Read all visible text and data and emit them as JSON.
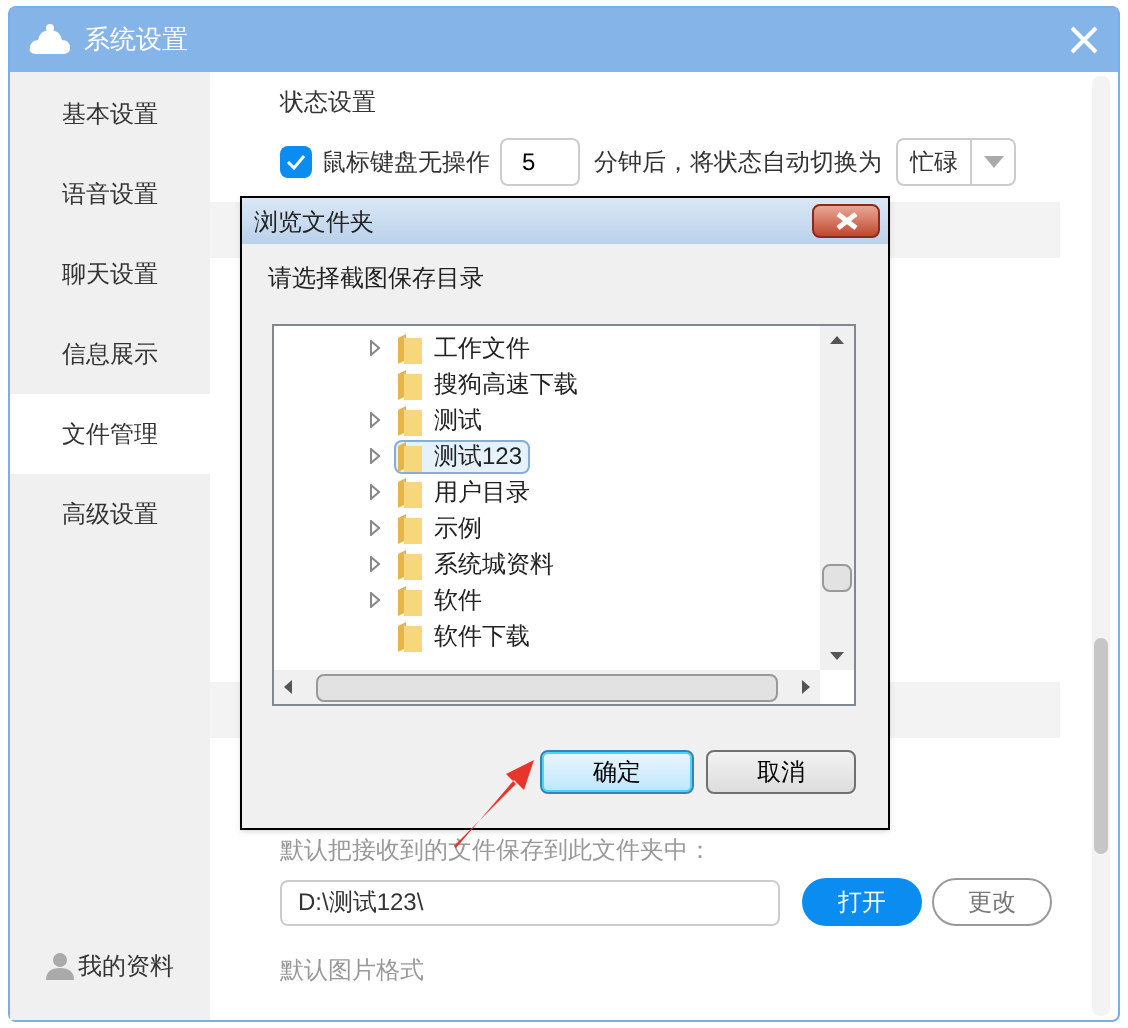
{
  "window": {
    "title": "系统设置"
  },
  "sidebar": {
    "items": [
      {
        "label": "基本设置",
        "selected": false
      },
      {
        "label": "语音设置",
        "selected": false
      },
      {
        "label": "聊天设置",
        "selected": false
      },
      {
        "label": "信息展示",
        "selected": false
      },
      {
        "label": "文件管理",
        "selected": true
      },
      {
        "label": "高级设置",
        "selected": false
      }
    ],
    "profile": "我的资料"
  },
  "status_section": {
    "heading": "状态设置",
    "idle_checkbox": {
      "label": "鼠标键盘无操作",
      "checked": true
    },
    "minutes": "5",
    "after_text": "分钟后，将状态自动切换为",
    "status_select": "忙碌"
  },
  "file_section": {
    "description": "默认把接收到的文件保存到此文件夹中：",
    "path": "D:\\测试123\\",
    "open_button": "打开",
    "change_button": "更改",
    "image_format_heading": "默认图片格式"
  },
  "dialog": {
    "title": "浏览文件夹",
    "prompt": "请选择截图保存目录",
    "folders": [
      {
        "name": "工作文件",
        "expandable": true,
        "selected": false
      },
      {
        "name": "搜狗高速下载",
        "expandable": false,
        "selected": false
      },
      {
        "name": "测试",
        "expandable": true,
        "selected": false
      },
      {
        "name": "测试123",
        "expandable": true,
        "selected": true
      },
      {
        "name": "用户目录",
        "expandable": true,
        "selected": false
      },
      {
        "name": "示例",
        "expandable": true,
        "selected": false
      },
      {
        "name": "系统城资料",
        "expandable": true,
        "selected": false
      },
      {
        "name": "软件",
        "expandable": true,
        "selected": false
      },
      {
        "name": "软件下载",
        "expandable": false,
        "selected": false
      }
    ],
    "ok_button": "确定",
    "cancel_button": "取消"
  }
}
